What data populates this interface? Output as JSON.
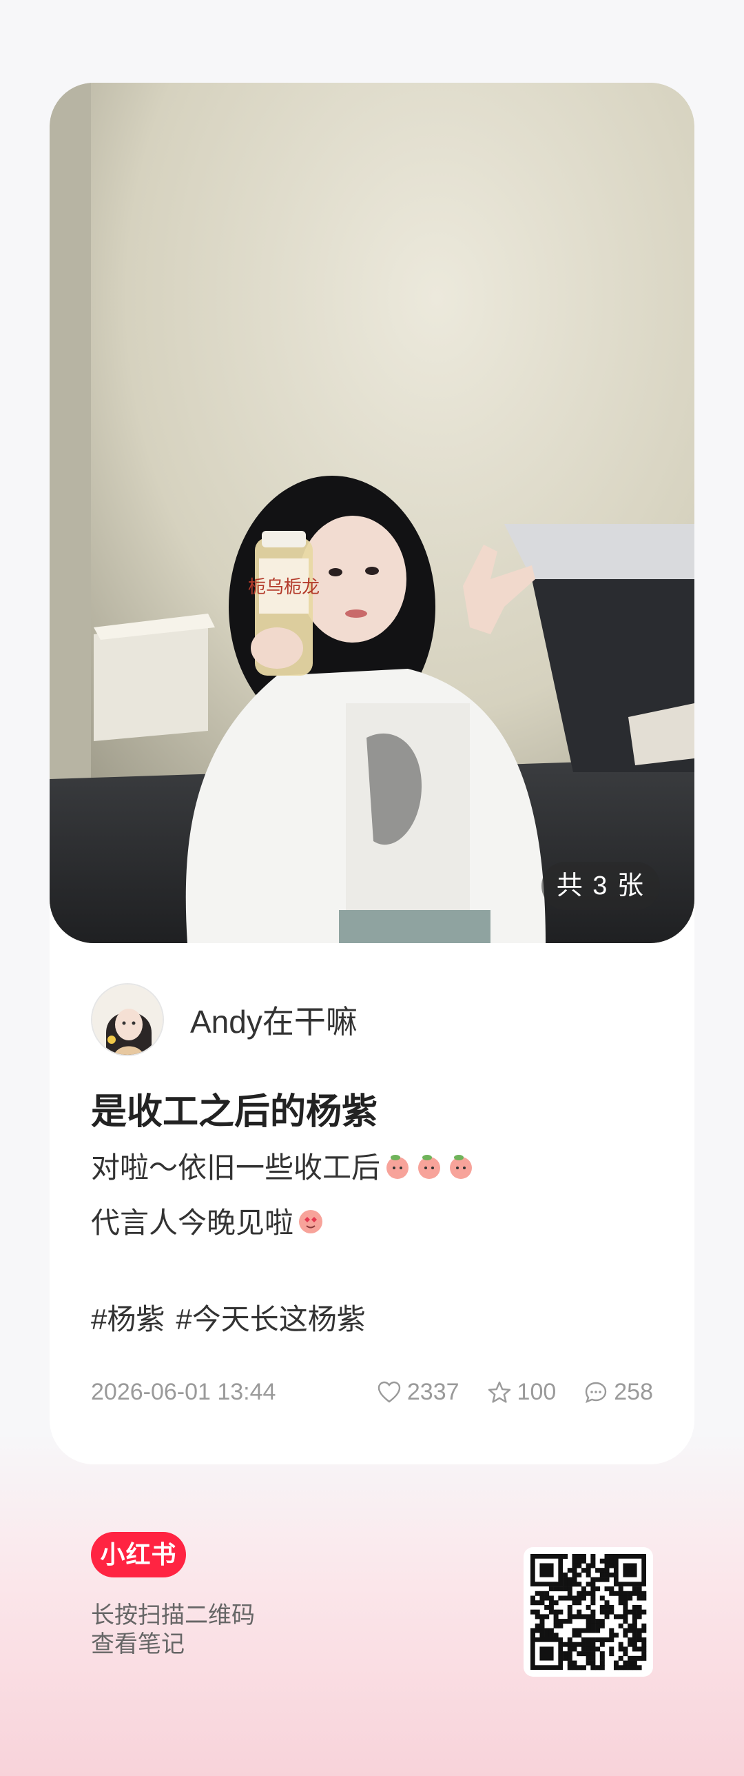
{
  "photo": {
    "count_label": "共 3 张",
    "product_label": "栀乌栀龙"
  },
  "author": {
    "name": "Andy在干嘛",
    "avatar_icon": "avatar-illustration"
  },
  "note": {
    "title": "是收工之后的杨紫",
    "line1": "对啦～依旧一些收工后",
    "line1_emojis": [
      "peach-icon",
      "peach-icon",
      "peach-icon"
    ],
    "line2": "代言人今晚见啦",
    "line2_emojis": [
      "heart-eyes-icon"
    ],
    "tags": [
      "#杨紫",
      "#今天长这杨紫"
    ]
  },
  "meta": {
    "timestamp": "2026-06-01 13:44",
    "likes": "2337",
    "collects": "100",
    "comments": "258"
  },
  "footer": {
    "brand": "小红书",
    "line1": "长按扫描二维码",
    "line2": "查看笔记"
  },
  "colors": {
    "brand": "#ff2442",
    "background_bottom": "#f8d3da",
    "muted_text": "#9a9a9a"
  }
}
